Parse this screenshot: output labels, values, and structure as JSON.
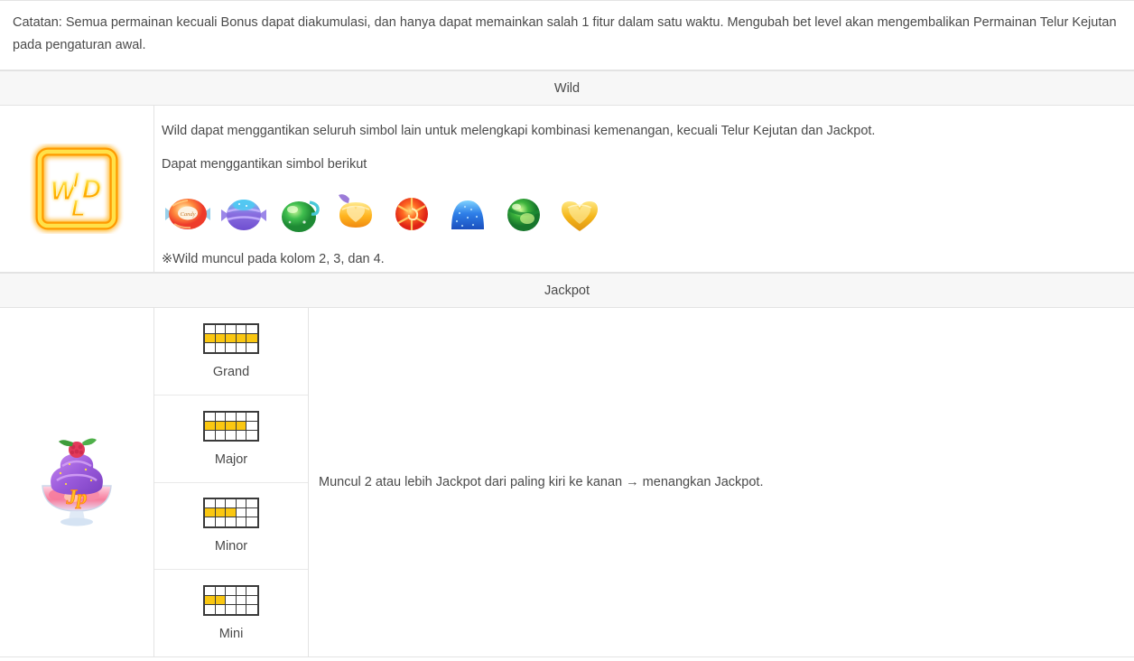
{
  "note": {
    "text": "Catatan: Semua permainan kecuali Bonus dapat diakumulasi, dan hanya dapat memainkan salah 1 fitur dalam satu waktu. Mengubah bet level akan mengembalikan Permainan Telur Kejutan pada pengaturan awal."
  },
  "wild": {
    "header": "Wild",
    "icon_name": "wild-logo",
    "icon_text": "WILD",
    "description": "Wild dapat menggantikan seluruh simbol lain untuk melengkapi kombinasi kemenangan, kecuali Telur Kejutan dan Jackpot.",
    "substitute_label": "Dapat menggantikan simbol berikut",
    "footnote": "※Wild muncul pada kolom 2, 3, dan 4.",
    "symbols": [
      {
        "name": "candy-wrapped-red",
        "color": "#F4623A",
        "color2": "#FFD24A"
      },
      {
        "name": "candy-wrapped-blue-purple",
        "color": "#7B6BD6",
        "color2": "#4FC3F7"
      },
      {
        "name": "candy-jelly-green",
        "color": "#35B84A",
        "color2": "#9BE06A"
      },
      {
        "name": "candy-heart-orange",
        "color": "#FFB221",
        "color2": "#FFE08A"
      },
      {
        "name": "candy-lollipop-red",
        "color": "#F0392B",
        "color2": "#FFB020"
      },
      {
        "name": "gumdrop-blue",
        "color": "#2A6FE0",
        "color2": "#63B7FF"
      },
      {
        "name": "candy-ball-green",
        "color": "#1E9E3C",
        "color2": "#8FE05A"
      },
      {
        "name": "candy-heart-gold",
        "color": "#F2B21C",
        "color2": "#FFE27A"
      }
    ]
  },
  "jackpot": {
    "header": "Jackpot",
    "icon_name": "jackpot-sundae",
    "description": "Muncul 2 atau lebih Jackpot dari paling kiri ke kanan → menangkan Jackpot.",
    "tiers": [
      {
        "label": "Grand",
        "filled": 5
      },
      {
        "label": "Major",
        "filled": 4
      },
      {
        "label": "Minor",
        "filled": 3
      },
      {
        "label": "Mini",
        "filled": 2
      }
    ],
    "reel": {
      "columns": 5,
      "rows": 3,
      "active_row": 2,
      "fill_color": "#FAC711"
    }
  }
}
